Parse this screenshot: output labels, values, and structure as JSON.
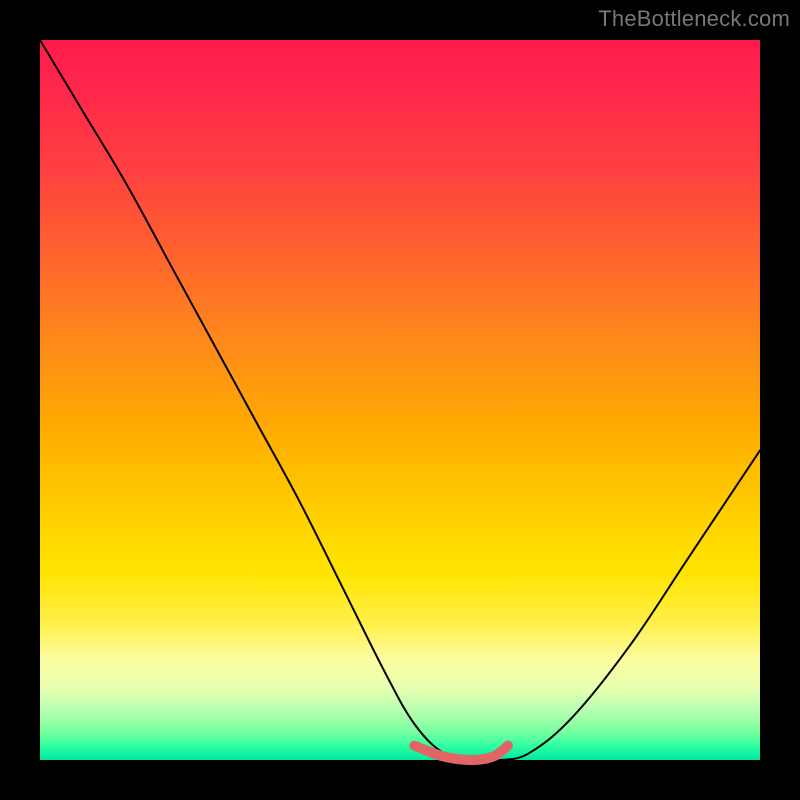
{
  "watermark": "TheBottleneck.com",
  "chart_data": {
    "type": "line",
    "title": "",
    "xlabel": "",
    "ylabel": "",
    "xlim": [
      0,
      100
    ],
    "ylim": [
      0,
      100
    ],
    "grid": false,
    "series": [
      {
        "name": "bottleneck-curve",
        "x": [
          0,
          6,
          12,
          18,
          24,
          30,
          36,
          42,
          48,
          52,
          56,
          60,
          64,
          68,
          74,
          82,
          90,
          98,
          100
        ],
        "values": [
          100,
          90,
          80,
          69,
          58,
          47,
          36,
          24,
          12,
          5,
          1,
          0,
          0,
          1,
          6,
          16,
          28,
          40,
          43
        ]
      },
      {
        "name": "flat-bottom-highlight",
        "x": [
          52,
          56,
          60,
          63,
          65
        ],
        "values": [
          2,
          0.5,
          0,
          0.5,
          2
        ]
      }
    ],
    "gradient_stops": [
      {
        "pos": 0,
        "color": "#ff1a4d"
      },
      {
        "pos": 18,
        "color": "#ff4040"
      },
      {
        "pos": 42,
        "color": "#ff8a1a"
      },
      {
        "pos": 66,
        "color": "#ffd000"
      },
      {
        "pos": 86,
        "color": "#fcfca0"
      },
      {
        "pos": 96,
        "color": "#7affa0"
      },
      {
        "pos": 100,
        "color": "#00e8a0"
      }
    ],
    "curve_color": "#000000",
    "highlight_color": "#e06666"
  }
}
